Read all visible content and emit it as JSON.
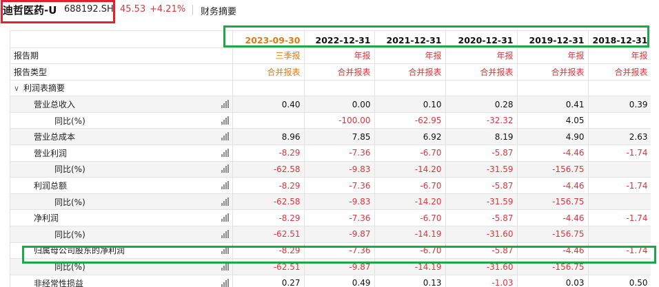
{
  "header": {
    "stock_name": "迪哲医药-U",
    "stock_code": "688192.SH",
    "price": "45.53",
    "change": "+4.21%",
    "tab_label": "财务摘要"
  },
  "table": {
    "periods": [
      "2023-09-30",
      "2022-12-31",
      "2021-12-31",
      "2020-12-31",
      "2019-12-31",
      "2018-12-31"
    ],
    "meta_rows": [
      {
        "label": "报告期",
        "values": [
          "三季报",
          "年报",
          "年报",
          "年报",
          "年报",
          "年报"
        ]
      },
      {
        "label": "报告类型",
        "values": [
          "合并报表",
          "合并报表",
          "合并报表",
          "合并报表",
          "合并报表",
          "合并报表"
        ]
      }
    ],
    "section_label": "利润表摘要",
    "rows": [
      {
        "label": "营业总收入",
        "level": 1,
        "values": [
          "0.40",
          "0.00",
          "0.10",
          "0.28",
          "0.41",
          "0.39"
        ]
      },
      {
        "label": "同比(%)",
        "level": 2,
        "values": [
          "",
          "-100.00",
          "-62.95",
          "-32.32",
          "4.05",
          ""
        ]
      },
      {
        "label": "营业总成本",
        "level": 1,
        "values": [
          "8.96",
          "7.85",
          "6.92",
          "8.19",
          "4.90",
          "2.63"
        ]
      },
      {
        "label": "营业利润",
        "level": 1,
        "values": [
          "-8.29",
          "-7.36",
          "-6.70",
          "-5.87",
          "-4.46",
          "-1.74"
        ]
      },
      {
        "label": "同比(%)",
        "level": 2,
        "values": [
          "-62.58",
          "-9.83",
          "-14.20",
          "-31.59",
          "-156.75",
          ""
        ]
      },
      {
        "label": "利润总额",
        "level": 1,
        "values": [
          "-8.29",
          "-7.36",
          "-6.70",
          "-5.87",
          "-4.46",
          "-1.74"
        ]
      },
      {
        "label": "同比(%)",
        "level": 2,
        "values": [
          "-62.58",
          "-9.83",
          "-14.20",
          "-31.59",
          "-156.75",
          ""
        ]
      },
      {
        "label": "净利润",
        "level": 1,
        "values": [
          "-8.29",
          "-7.36",
          "-6.70",
          "-5.87",
          "-4.46",
          "-1.74"
        ]
      },
      {
        "label": "同比(%)",
        "level": 2,
        "values": [
          "-62.51",
          "-9.87",
          "-14.19",
          "-31.60",
          "-156.75",
          ""
        ]
      },
      {
        "label": "归属母公司股东的净利润",
        "level": 1,
        "values": [
          "-8.29",
          "-7.36",
          "-6.70",
          "-5.87",
          "-4.46",
          "-1.74"
        ]
      },
      {
        "label": "同比(%)",
        "level": 2,
        "values": [
          "-62.51",
          "-9.87",
          "-14.19",
          "-31.60",
          "-156.75",
          ""
        ]
      },
      {
        "label": "非经常性损益",
        "level": 1,
        "values": [
          "0.27",
          "0.49",
          "0.13",
          "-1.03",
          "0.03",
          "0.50"
        ]
      }
    ]
  },
  "colors": {
    "negative": "#e0333a",
    "accent_orange": "#e07a10",
    "highlight_red": "#e5202e",
    "highlight_green": "#1fa64a"
  }
}
